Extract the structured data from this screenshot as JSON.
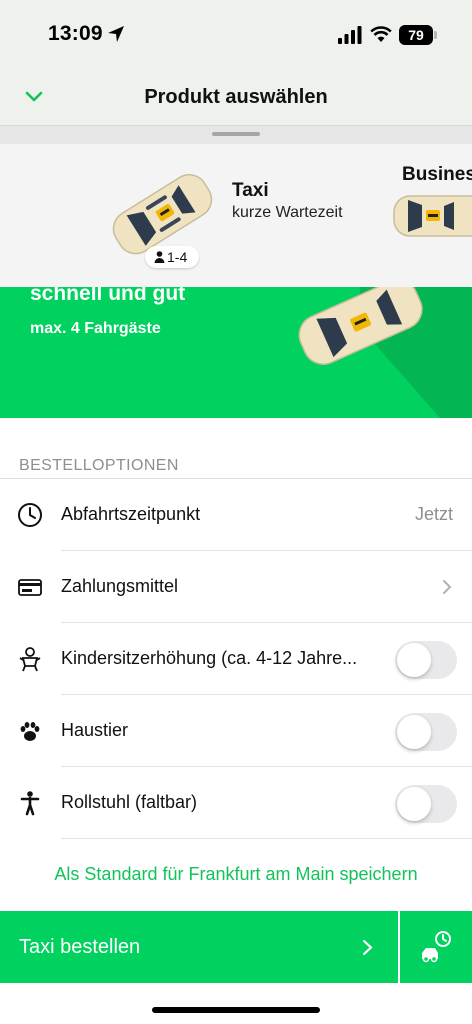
{
  "status_bar": {
    "time": "13:09",
    "battery": "79"
  },
  "header": {
    "title": "Produkt auswählen"
  },
  "products": [
    {
      "name": "Taxi",
      "subtitle": "kurze Wartezeit",
      "passengers": "1-4"
    },
    {
      "name": "Business"
    }
  ],
  "banner": {
    "title": "schnell und gut",
    "subtitle": "max. 4 Fahrgäste"
  },
  "order_options": {
    "section_title": "BESTELLOPTIONEN",
    "departure": {
      "label": "Abfahrtszeitpunkt",
      "value": "Jetzt"
    },
    "payment": {
      "label": "Zahlungsmittel"
    },
    "child_seat": {
      "label": "Kindersitzerhöhung (ca. 4-12 Jahre...",
      "enabled": false
    },
    "pet": {
      "label": "Haustier",
      "enabled": false
    },
    "wheelchair": {
      "label": "Rollstuhl (faltbar)",
      "enabled": false
    }
  },
  "save_default_link": "Als Standard für Frankfurt am Main speichern",
  "order_button": {
    "label": "Taxi bestellen"
  },
  "colors": {
    "brand_green": "#00d15f",
    "link_green": "#12c35a",
    "taxi_beige": "#efe3c2",
    "taxi_sign": "#f2b705"
  },
  "icons": [
    "location-arrow-icon",
    "signal-icon",
    "wifi-icon",
    "chevron-down-icon",
    "person-icon",
    "clock-icon",
    "card-icon",
    "child-seat-icon",
    "paw-icon",
    "wheelchair-icon",
    "chevron-right-icon",
    "schedule-taxi-icon"
  ]
}
